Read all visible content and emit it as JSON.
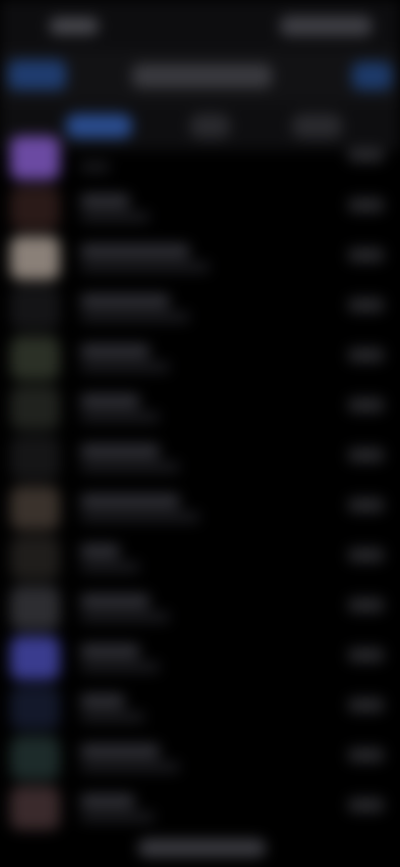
{
  "colors": {
    "background": "#000000",
    "accent": "#2a4c8e",
    "bar": "#121214",
    "text_placeholder": "#303036"
  },
  "status_bar": {
    "time": "",
    "icons": [
      "signal-icon",
      "wifi-icon",
      "battery-icon"
    ]
  },
  "top_nav": {
    "left_button": "",
    "title": "",
    "right_button": ""
  },
  "filters": [
    {
      "label": "",
      "active": true
    },
    {
      "label": "",
      "active": false
    },
    {
      "label": "",
      "active": false
    }
  ],
  "list": {
    "rows": [
      {
        "title": "",
        "subtitle": "",
        "meta": "",
        "avatar_color": "#6b4aa2"
      },
      {
        "title": "",
        "subtitle": "",
        "meta": "",
        "avatar_color": "#2a1a18"
      },
      {
        "title": "",
        "subtitle": "",
        "meta": "",
        "avatar_color": "#8a8078"
      },
      {
        "title": "",
        "subtitle": "",
        "meta": "",
        "avatar_color": "#141416"
      },
      {
        "title": "",
        "subtitle": "",
        "meta": "",
        "avatar_color": "#2b3026"
      },
      {
        "title": "",
        "subtitle": "",
        "meta": "",
        "avatar_color": "#20221e"
      },
      {
        "title": "",
        "subtitle": "",
        "meta": "",
        "avatar_color": "#151516"
      },
      {
        "title": "",
        "subtitle": "",
        "meta": "",
        "avatar_color": "#3a322c"
      },
      {
        "title": "",
        "subtitle": "",
        "meta": "",
        "avatar_color": "#1f1d1b"
      },
      {
        "title": "",
        "subtitle": "",
        "meta": "",
        "avatar_color": "#2d2d31"
      },
      {
        "title": "",
        "subtitle": "",
        "meta": "",
        "avatar_color": "#3a3c8e"
      },
      {
        "title": "",
        "subtitle": "",
        "meta": "",
        "avatar_color": "#13182a"
      },
      {
        "title": "",
        "subtitle": "",
        "meta": "",
        "avatar_color": "#1d2b2a"
      },
      {
        "title": "",
        "subtitle": "",
        "meta": "",
        "avatar_color": "#3a2a2c"
      }
    ]
  }
}
